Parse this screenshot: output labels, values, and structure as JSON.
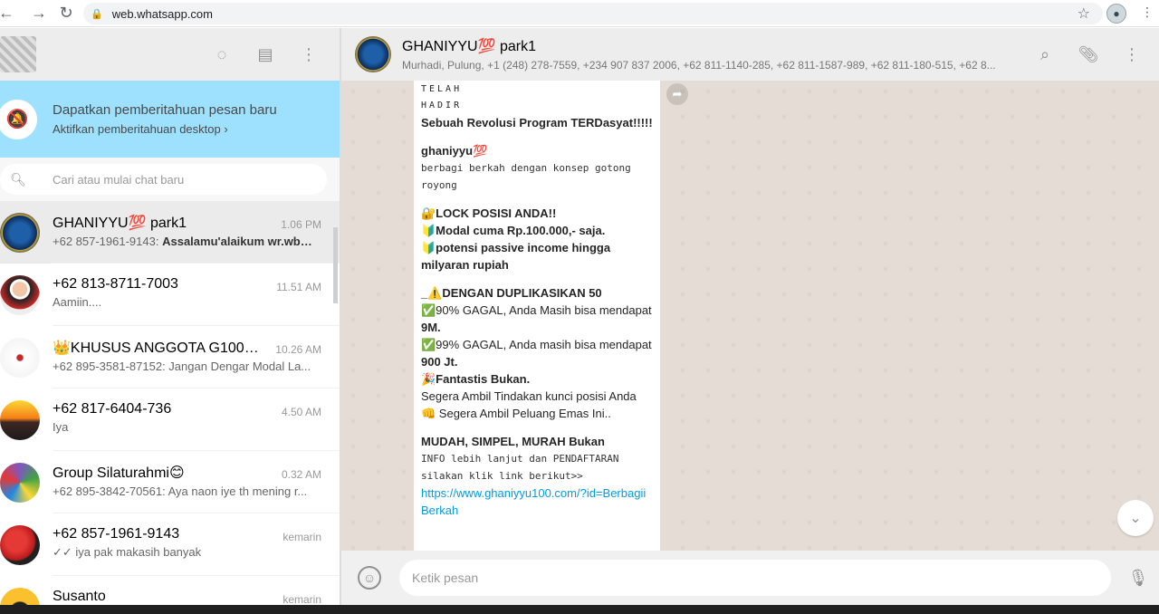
{
  "browser": {
    "url": "web.whatsapp.com"
  },
  "left_panel": {
    "notification": {
      "title": "Dapatkan pemberitahuan pesan baru",
      "subtitle": "Aktifkan pemberitahuan desktop ›"
    },
    "search": {
      "placeholder": "Cari atau mulai chat baru"
    },
    "chats": [
      {
        "name": "GHANIYYU💯 park1",
        "time": "1.06 PM",
        "sender": "+62 857-1961-9143:",
        "preview": "Assalamu'alaikum wr.wb…",
        "avatar_color": "#1e5fa8"
      },
      {
        "name": "+62 813-8711-7003",
        "time": "11.51 AM",
        "sender": "",
        "preview": "Aamiin....",
        "avatar_color": "#c62828"
      },
      {
        "name": "👑KHUSUS ANGGOTA G100👑",
        "time": "10.26 AM",
        "sender": "",
        "preview": "+62 895-3581-87152: Jangan Dengar Modal La...",
        "avatar_color": "#f5f5f5"
      },
      {
        "name": "+62 817-6404-736",
        "time": "4.50 AM",
        "sender": "",
        "preview": "Iya",
        "avatar_color": "#f9a825"
      },
      {
        "name": "Group Silaturahmi😊",
        "time": "0.32 AM",
        "sender": "",
        "preview": "+62 895-3842-70561: Aya naon iye th mening r...",
        "avatar_color": "#7e57c2"
      },
      {
        "name": "+62 857-1961-9143",
        "time": "kemarin",
        "sender": "",
        "preview": "✓✓ iya pak makasih banyak",
        "avatar_color": "#b71c1c"
      },
      {
        "name": "Susanto",
        "time": "kemarin",
        "sender": "",
        "preview": "",
        "avatar_color": "#fbc02d"
      }
    ]
  },
  "chat": {
    "name": "GHANIYYU💯 park1",
    "members": "Murhadi, Pulung, +1 (248) 278-7559, +234 907 837 2006, +62 811-1140-285, +62 811-1587-989, +62 811-180-515, +62 8...",
    "message": {
      "line_1": "TELAH",
      "line_2": "HADIR",
      "headline": "Sebuah Revolusi Program TERDasyat!!!!!",
      "brand": "ghaniyyu💯",
      "tagline": "berbagi berkah dengan konsep gotong royong",
      "lock": "🔐LOCK POSISI ANDA!!",
      "modal": "🔰Modal cuma Rp.100.000,- saja.",
      "potensi": "🔰potensi passive income hingga milyaran rupiah",
      "dup_title": "_⚠️DENGAN DUPLIKASIKAN 50",
      "gagal_90_a": "✅90% GAGAL, Anda Masih bisa mendapat ",
      "gagal_90_b": "9M.",
      "gagal_99_a": "✅99% GAGAL, Anda masih bisa mendapat ",
      "gagal_99_b": "900 Jt.",
      "fantastis": " 🎉Fantastis Bukan.",
      "segera_1": " Segera Ambil Tindakan kunci posisi Anda",
      "segera_2": "👊 Segera Ambil Peluang Emas Ini..",
      "mudah": "MUDAH, SIMPEL, MURAH Bukan",
      "info": " INFO lebih lanjut dan PENDAFTARAN silakan klik link berikut>>",
      "link": "https://www.ghaniyyu100.com/?id=BerbagiiBerkah"
    }
  },
  "composer": {
    "placeholder": "Ketik pesan"
  }
}
